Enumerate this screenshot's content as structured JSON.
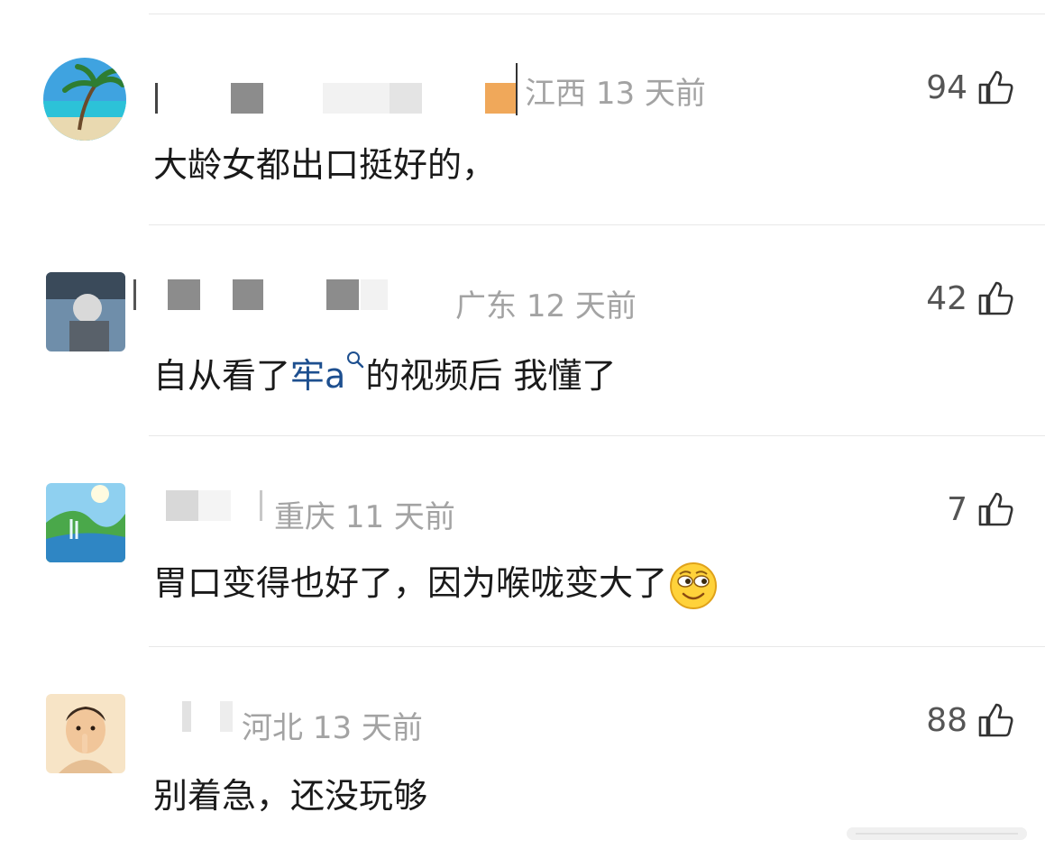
{
  "comments": [
    {
      "location": "江西",
      "time": "13 天前",
      "likes": "94",
      "text": "大龄女都出口挺好的，"
    },
    {
      "location": "广东",
      "time": "12 天前",
      "likes": "42",
      "text_before": "自从看了",
      "topic": "牢a",
      "text_after": "的视频后  我懂了"
    },
    {
      "location": "重庆",
      "time": "11 天前",
      "likes": "7",
      "text": "胃口变得也好了，因为喉咙变大了"
    },
    {
      "location": "河北",
      "time": "13 天前",
      "likes": "88",
      "text": "别着急，还没玩够"
    }
  ],
  "icons": {
    "like": "thumbs-up-icon",
    "search": "search-icon",
    "emoji": "smirk-emoji-icon"
  }
}
